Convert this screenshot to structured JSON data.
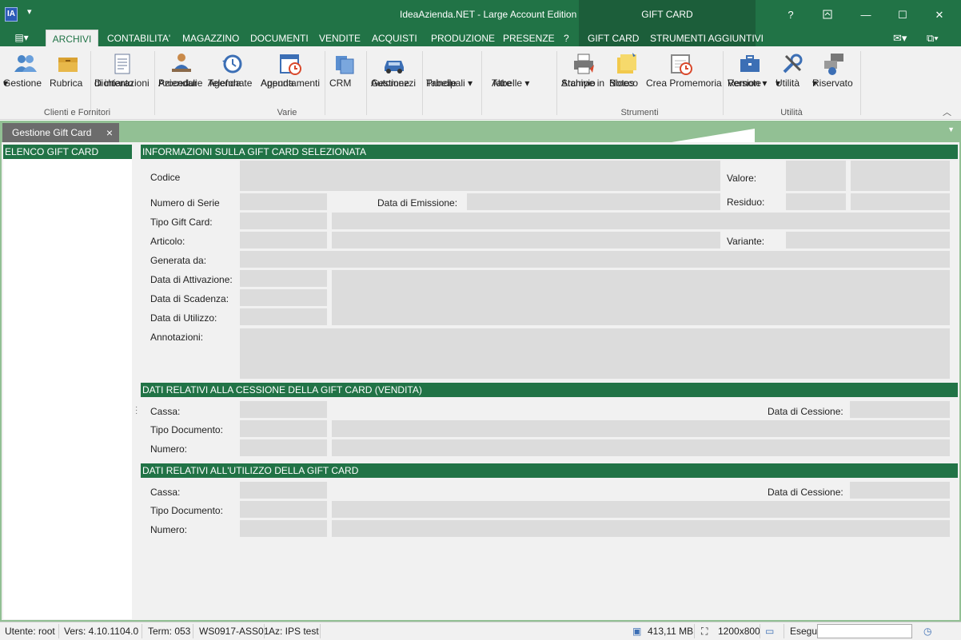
{
  "window": {
    "title": "IdeaAzienda.NET - Large Account Edition",
    "context_tab_group": "GIFT CARD",
    "help": "?"
  },
  "ribbon_tabs": [
    "ARCHIVI",
    "CONTABILITA'",
    "MAGAZZINO",
    "DOCUMENTI",
    "VENDITE",
    "ACQUISTI",
    "PRODUZIONE",
    "PRESENZE",
    "?",
    "GIFT CARD",
    "STRUMENTI AGGIUNTIVI"
  ],
  "ribbon": {
    "buttons": [
      {
        "label": "Gestione",
        "label2": "▾",
        "icon": "users-icon"
      },
      {
        "label": "Rubrica",
        "label2": "",
        "icon": "address-box-icon"
      },
      {
        "label": "Dichiarazioni",
        "label2": "di intento",
        "icon": "document-icon"
      },
      {
        "label": "Procedure",
        "label2": "Aziendali",
        "icon": "person-desk-icon"
      },
      {
        "label": "Agenda",
        "label2": "Telefonate",
        "icon": "history-clock-icon"
      },
      {
        "label": "Agenda",
        "label2": "Appuntamenti",
        "icon": "calendar-clock-icon"
      },
      {
        "label": "CRM",
        "label2": "",
        "icon": "crm-stack-icon"
      },
      {
        "label": "Gestione",
        "label2": "Automezzi",
        "icon": "car-icon"
      },
      {
        "label": "Tabelle",
        "label2": "Principali ▾",
        "icon": ""
      },
      {
        "label": "Altre",
        "label2": "Tabelle ▾",
        "icon": ""
      },
      {
        "label": "Stampe in",
        "label2": "Archivio",
        "icon": "printer-icon"
      },
      {
        "label": "Blocco",
        "label2": "Notes",
        "icon": "sticky-note-icon"
      },
      {
        "label": "Crea Promemoria",
        "label2": "",
        "icon": "reminder-calendar-icon"
      },
      {
        "label": "Remote",
        "label2": "Version ▾",
        "icon": "briefcase-icon"
      },
      {
        "label": "Utilità",
        "label2": "▾",
        "icon": "tools-icon"
      },
      {
        "label": "Riservato",
        "label2": "▾",
        "icon": "reserved-icon"
      }
    ],
    "groups": [
      "Clienti e Fornitori",
      "Varie",
      "Strumenti",
      "Utilità"
    ]
  },
  "doc_tab": {
    "label": "Gestione Gift Card",
    "close": "×"
  },
  "left_panel": {
    "header": "ELENCO GIFT CARD"
  },
  "info_section": {
    "header": "INFORMAZIONI SULLA GIFT CARD SELEZIONATA",
    "codice": "Codice",
    "valore": "Valore:",
    "numero_serie": "Numero di Serie",
    "data_emissione": "Data di Emissione:",
    "residuo": "Residuo:",
    "tipo": "Tipo Gift Card:",
    "articolo": "Articolo:",
    "variante": "Variante:",
    "generata_da": "Generata da:",
    "data_attivazione": "Data di Attivazione:",
    "data_scadenza": "Data di Scadenza:",
    "data_utilizzo": "Data di Utilizzo:",
    "annotazioni": "Annotazioni:"
  },
  "cessione_section": {
    "header": "DATI RELATIVI ALLA CESSIONE DELLA GIFT CARD (VENDITA)",
    "cassa": "Cassa:",
    "data_cessione": "Data di Cessione:",
    "tipo_documento": "Tipo Documento:",
    "numero": "Numero:"
  },
  "utilizzo_section": {
    "header": "DATI RELATIVI ALL'UTILIZZO DELLA GIFT CARD",
    "cassa": "Cassa:",
    "data_cessione": "Data di Cessione:",
    "tipo_documento": "Tipo Documento:",
    "numero": "Numero:"
  },
  "status": {
    "utente": "Utente: root",
    "versione": "Vers: 4.10.1104.0",
    "term": "Term: 053",
    "ws": "WS0917-ASS01",
    "az": "Az: IPS test",
    "memory": "413,11 MB",
    "resolution": "1200x800",
    "esegui": "Esegui"
  },
  "colors": {
    "accent": "#217346",
    "context": "#1c5e3a",
    "tabstrip": "#92c094"
  }
}
